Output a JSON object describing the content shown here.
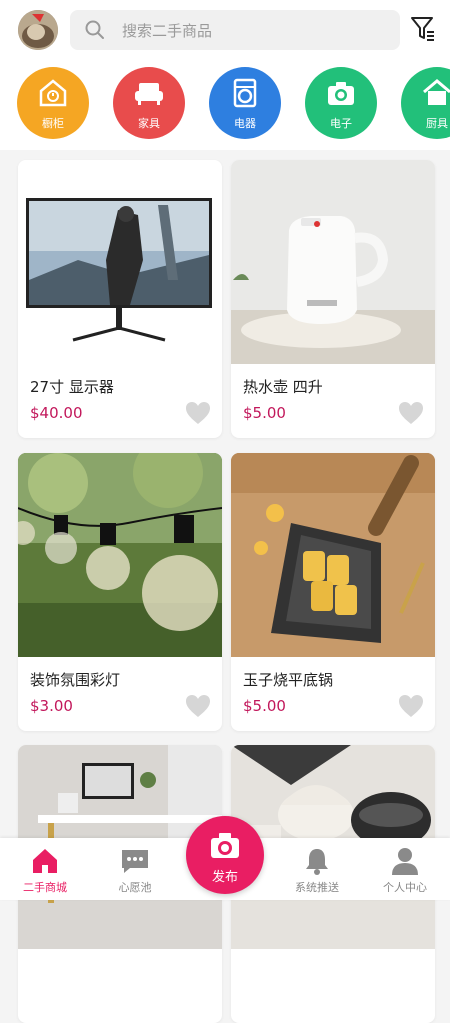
{
  "search": {
    "placeholder": "搜索二手商品"
  },
  "categories": [
    {
      "label": "橱柜",
      "color": "#f5a623",
      "icon": "cabinet-icon"
    },
    {
      "label": "家具",
      "color": "#e84c4c",
      "icon": "sofa-icon"
    },
    {
      "label": "电器",
      "color": "#2e7fe0",
      "icon": "appliance-icon"
    },
    {
      "label": "电子",
      "color": "#22c07a",
      "icon": "camera-icon"
    },
    {
      "label": "厨具",
      "color": "#22c07a",
      "icon": "house-icon"
    }
  ],
  "products": [
    {
      "title": "27寸 显示器",
      "price": "$40.00"
    },
    {
      "title": "热水壶 四升",
      "price": "$5.00"
    },
    {
      "title": "装饰氛围彩灯",
      "price": "$3.00"
    },
    {
      "title": "玉子烧平底锅",
      "price": "$5.00"
    },
    {
      "title": "",
      "price": ""
    },
    {
      "title": "",
      "price": ""
    }
  ],
  "tabs": [
    {
      "label": "二手商城",
      "active": true,
      "icon": "home-icon"
    },
    {
      "label": "心愿池",
      "active": false,
      "icon": "chat-icon"
    },
    {
      "label": "系统推送",
      "active": false,
      "icon": "bell-icon"
    },
    {
      "label": "个人中心",
      "active": false,
      "icon": "person-icon"
    }
  ],
  "fab": {
    "label": "发布",
    "icon": "camera-icon"
  },
  "colors": {
    "accent": "#e91e63",
    "price": "#c2185b"
  }
}
